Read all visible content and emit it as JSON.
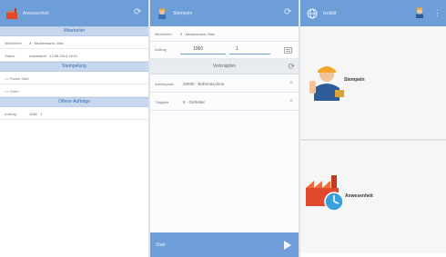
{
  "screen1": {
    "title": "Anwesenheit",
    "section_mitarbeiter": "Mitarbeiter",
    "mitarbeiter_label": "Mitarbeiter",
    "mitarbeiter_value": "3 · Mustermann, Max",
    "status_label": "Status",
    "status_value": "Anwesend · 13.08.2014 16:01",
    "section_stempelung": "Stempelung",
    "stempel_items": [
      "=> Pause Start",
      "=> Gehe"
    ],
    "section_auftraege": "Offene Aufträge",
    "auftrag_label": "Auftrag",
    "auftrag_value": "1060 · 1",
    "colors": {
      "bar": "#6d9ed8",
      "section": "#c7d8ee"
    }
  },
  "screen2": {
    "title": "Stempeln",
    "mitarbeiter_label": "Mitarbeiter",
    "mitarbeiter_value": "3 · Mustermann, Max",
    "auftrag_label": "Auftrag",
    "auftrag_value": "1060",
    "auftrag_pos": "1",
    "verknuepfen_label": "Verknüpfen",
    "arbeitsplatz_label": "Arbeitsplatz",
    "arbeitsplatz_value": "20030 · Bohrmaschine",
    "taetigkeit_label": "Tätigkeit",
    "taetigkeit_value": "8 · Gefreiter",
    "start_label": "Start"
  },
  "screen3": {
    "title": "Isolditt",
    "tile1_label": "Stempeln",
    "tile2_label": "Anwesenheit"
  }
}
